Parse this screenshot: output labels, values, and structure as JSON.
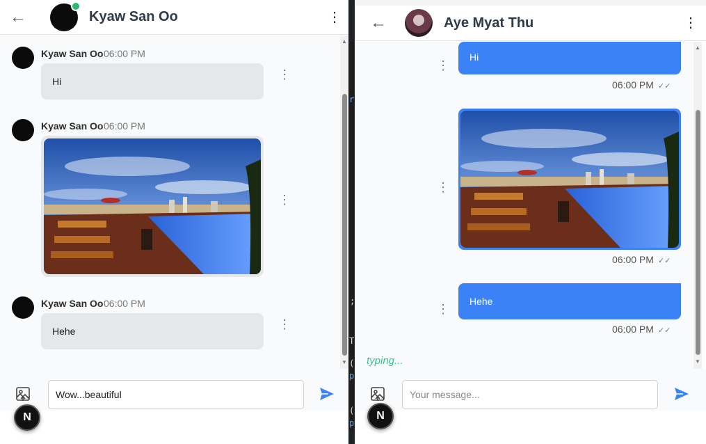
{
  "colors": {
    "accent": "#3b82f6",
    "online": "#2bb673",
    "typing": "#34c38f",
    "incoming_bubble": "#e5e7eb"
  },
  "left_chat": {
    "header": {
      "back_icon": "arrow-left-icon",
      "name": "Kyaw San Oo",
      "menu_icon": "kebab-vertical-icon"
    },
    "messages": [
      {
        "sender": "Kyaw San Oo",
        "time": "06:00 PM",
        "type": "text",
        "text": "Hi"
      },
      {
        "sender": "Kyaw San Oo",
        "time": "06:00 PM",
        "type": "image"
      },
      {
        "sender": "Kyaw San Oo",
        "time": "06:00 PM",
        "type": "text",
        "text": "Hehe"
      }
    ],
    "composer": {
      "value": "Wow...beautiful",
      "placeholder": "Your message...",
      "attach_icon": "image-upload-icon",
      "send_icon": "send-icon"
    },
    "badge": "N"
  },
  "right_chat": {
    "header": {
      "back_icon": "arrow-left-icon",
      "name": "Aye Myat Thu",
      "menu_icon": "kebab-vertical-icon"
    },
    "messages": [
      {
        "type": "text",
        "text": "Hi",
        "time": "06:00 PM",
        "status_icon": "double-check-icon"
      },
      {
        "type": "image",
        "time": "06:00 PM",
        "status_icon": "double-check-icon"
      },
      {
        "type": "text",
        "text": "Hehe",
        "time": "06:00 PM",
        "status_icon": "double-check-icon"
      }
    ],
    "typing": "typing...",
    "composer": {
      "value": "",
      "placeholder": "Your message...",
      "attach_icon": "image-upload-icon",
      "send_icon": "send-icon"
    },
    "badge": "N"
  },
  "terminal_glyphs": {
    "a": "r",
    "b": ";",
    "c": "T",
    "d": "(",
    "e": "p",
    "f": "(",
    "g": "p"
  }
}
